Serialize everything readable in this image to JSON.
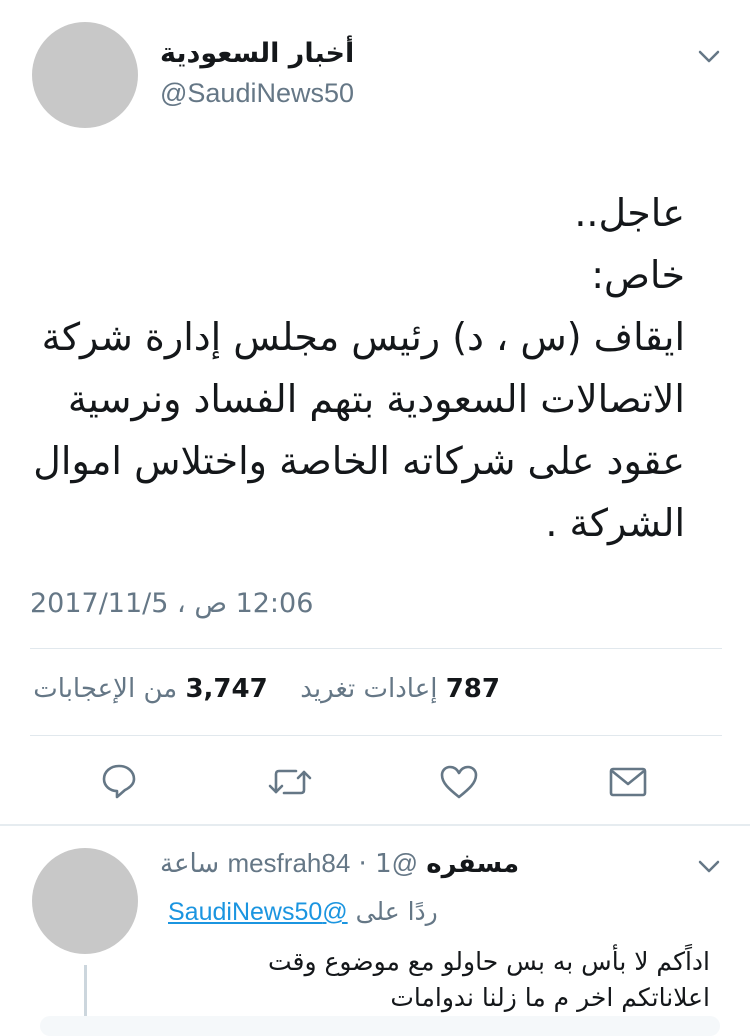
{
  "tweet": {
    "display_name": "أخبار السعودية",
    "handle": "@SaudiNews50",
    "lines": [
      "عاجل..",
      "خاص:",
      "ايقاف (س ، د) رئيس مجلس إدارة شركة",
      "الاتصالات السعودية بتهم الفساد ونرسية",
      "عقود على شركاته الخاصة واختلاس اموال",
      "الشركة ."
    ],
    "timestamp": "12:06 ص ، 2017/11/5",
    "stats": {
      "retweets_count": "787",
      "retweets_label": "إعادات تغريد",
      "likes_count": "3,747",
      "likes_label": "من الإعجابات"
    },
    "actions": {
      "reply": "reply-icon",
      "retweet": "retweet-icon",
      "like": "heart-icon",
      "dm": "envelope-icon"
    }
  },
  "reply": {
    "display_name": "مسفره",
    "handle": "@mesfrah84",
    "time": "1 ساعة",
    "replying_to_label": "ردًا على",
    "replying_to_handle": "@SaudiNews50",
    "text_line1": "اداًكم لا بأس به بس حاولو مع موضوع وقت",
    "text_line2": "اعلاناتكم اخر م ما زلنا ندوامات"
  },
  "colors": {
    "link": "#1b95e0",
    "muted": "#657786",
    "divider": "#e1e8ed",
    "avatar": "#c8c8c8"
  }
}
